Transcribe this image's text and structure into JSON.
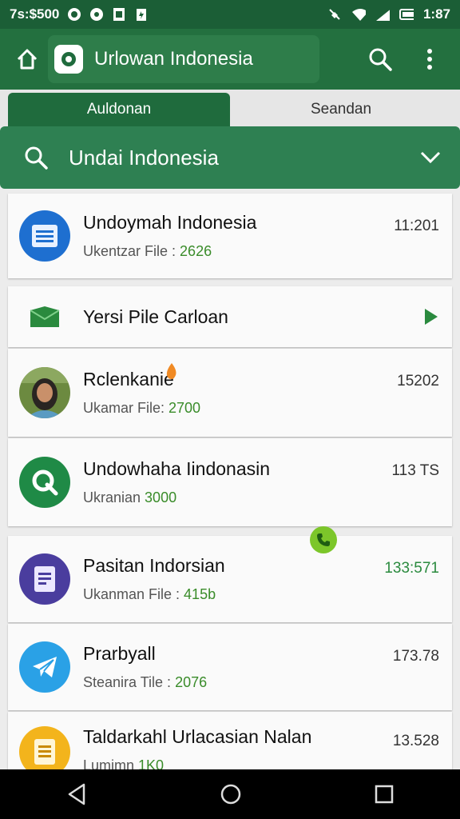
{
  "status_bar": {
    "left_text": "7s:$500",
    "time": "1:87"
  },
  "app_bar": {
    "title": "Urlowan Indonesia"
  },
  "tabs": [
    {
      "label": "Auldonan"
    },
    {
      "label": "Seandan"
    }
  ],
  "search": {
    "text": "Undai Indonesia"
  },
  "list": [
    {
      "title": "Undoymah Indonesia",
      "sub_label": "Ukentzar File : ",
      "sub_value": "2626",
      "time": "11:201",
      "icon": "document-icon",
      "color": "#1e6fd0"
    },
    {
      "title": "Yersi Pile Carloan",
      "icon": "mail-icon",
      "color": "#2a8a3e"
    },
    {
      "title": "Rclenkanie",
      "sub_label": "Ukamar File: ",
      "sub_value": "2700",
      "time": "15202",
      "icon": "avatar-photo"
    },
    {
      "title": "Undowhaha Iindonasin",
      "sub_label": "Ukranian ",
      "sub_value": "3000",
      "time": "113 TS",
      "icon": "search-q-icon",
      "color": "#1f8a46"
    },
    {
      "title": "Pasitan Indorsian",
      "sub_label": "Ukanman File : ",
      "sub_value": "415b",
      "time": "133:571",
      "icon": "doc-purple-icon",
      "color": "#4a3d9e"
    },
    {
      "title": "Prarbyall",
      "sub_label": "Steanira Tile : ",
      "sub_value": "2076",
      "time": "173.78",
      "icon": "telegram-icon",
      "color": "#2aa1e6"
    },
    {
      "title": "Taldarkahl Urlacasian Nalan",
      "sub_label": "Lumimn ",
      "sub_value": "1K0",
      "time": "13.528",
      "icon": "notes-icon",
      "color": "#f3b41c"
    }
  ]
}
